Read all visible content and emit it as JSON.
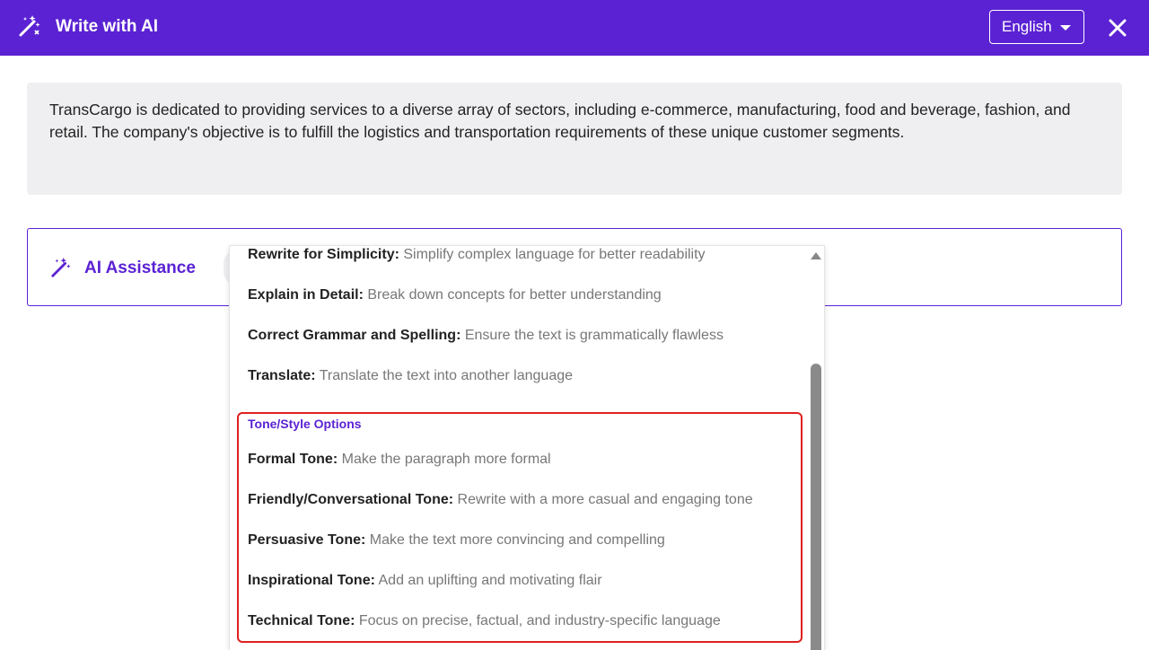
{
  "header": {
    "title": "Write with AI",
    "language": "English"
  },
  "text_box": {
    "content": "TransCargo is dedicated to providing services to a diverse array of sectors, including e-commerce, manufacturing, food and beverage, fashion, and retail. The company's objective is to fulfill the logistics and transportation requirements of these unique customer segments."
  },
  "ai_bar": {
    "label": "AI Assistance"
  },
  "dropdown": {
    "items": [
      {
        "name": "Rewrite for Simplicity",
        "desc": "Simplify complex language for better readability"
      },
      {
        "name": "Explain in Detail",
        "desc": "Break down concepts for better understanding"
      },
      {
        "name": "Correct Grammar and Spelling",
        "desc": "Ensure the text is grammatically flawless"
      },
      {
        "name": "Translate",
        "desc": "Translate the text into another language"
      }
    ],
    "tone_group_label": "Tone/Style Options",
    "tone_items": [
      {
        "name": "Formal Tone",
        "desc": "Make the paragraph more formal"
      },
      {
        "name": "Friendly/Conversational Tone",
        "desc": "Rewrite with a more casual and engaging tone"
      },
      {
        "name": "Persuasive Tone",
        "desc": "Make the text more convincing and compelling"
      },
      {
        "name": "Inspirational Tone",
        "desc": "Add an uplifting and motivating flair"
      },
      {
        "name": "Technical Tone",
        "desc": "Focus on precise, factual, and industry-specific language"
      }
    ]
  },
  "colors": {
    "brand": "#5b22d3",
    "highlight": "#e0201e",
    "text_bg": "#efeff1"
  },
  "icons": {
    "header": "magic-wand-icon",
    "close": "close-icon",
    "ai": "magic-wand-icon"
  }
}
